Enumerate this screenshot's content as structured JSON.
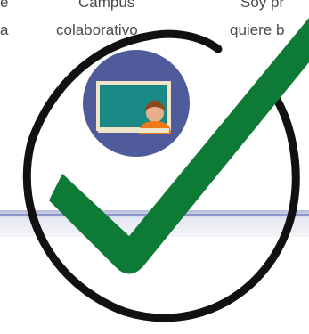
{
  "page": {
    "left_column": {
      "line1": "e",
      "line2": "a"
    },
    "campus_item": {
      "line1": "Campus",
      "line2": "colaborativo",
      "icon": "teacher-at-chalkboard-icon"
    },
    "right_column": {
      "line1": "Soy pr",
      "line2": "quiere b"
    },
    "overlay": {
      "icon": "check-circle-icon",
      "check_color": "#0d7a35",
      "circle_color": "#111111"
    }
  }
}
